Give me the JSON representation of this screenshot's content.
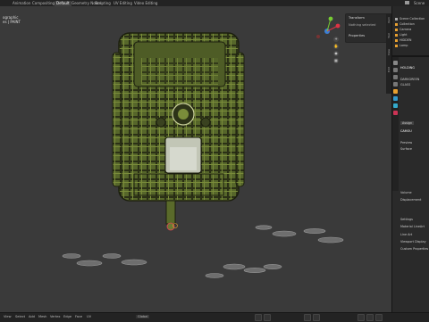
{
  "workspace_tabs": [
    "Animation",
    "Compositing",
    "Default",
    "Geometry Nodes",
    "Scripting",
    "UV Editing",
    "Video Editing"
  ],
  "active_tab_index": 2,
  "scene_label": "Scene",
  "viewport": {
    "overlay_line1": "ographic",
    "overlay_line2": "es | PAINT",
    "object_description": "green plaid-textured trail camera model on a stand"
  },
  "npanel": {
    "transform_header": "Transform",
    "nothing_selected": "Nothing selected",
    "properties_header": "Properties"
  },
  "outliner": {
    "rows": [
      "Scene Collection",
      "Collection",
      "Camera",
      "Light",
      "HIDDEN",
      "Lamp"
    ]
  },
  "properties": {
    "object_name": "HOLDING",
    "material_slots": [
      "DARKGREEN",
      "GLASS"
    ],
    "material_name": "CAMOU",
    "buttons": [
      "Assign"
    ],
    "sections": [
      "Preview",
      "Surface",
      "Volume",
      "Displacement",
      "Settings",
      "Material LineArt",
      "Line Art",
      "Viewport Display",
      "Custom Properties"
    ]
  },
  "statusbar": {
    "menus": [
      "View",
      "Select",
      "Add",
      "Mesh",
      "Vertex",
      "Edge",
      "Face",
      "UV"
    ],
    "mode": "Global"
  },
  "colors": {
    "viewport_bg": "#3a3a3a",
    "camera_body": "#5a6a2a",
    "camera_dark": "#2b2f16",
    "accent": "#e8a030"
  }
}
